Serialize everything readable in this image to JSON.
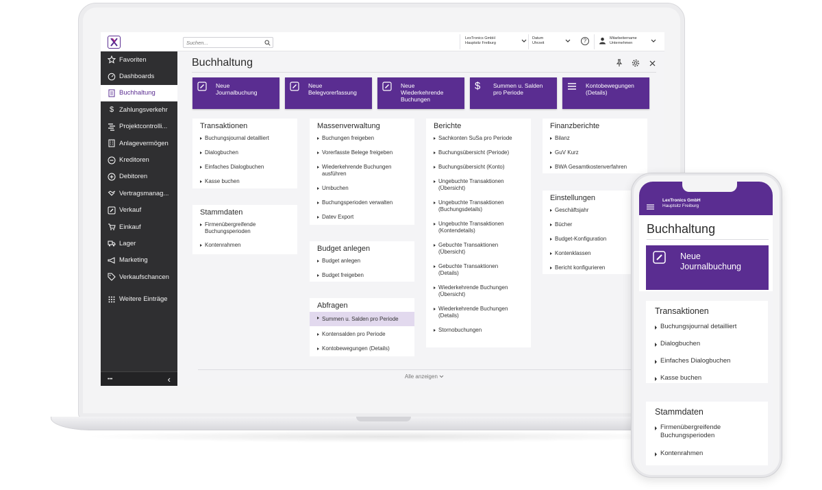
{
  "app": {
    "accent": "#5a2d91"
  },
  "sidebar": {
    "items": [
      {
        "label": "Favoriten",
        "icon": "star-icon"
      },
      {
        "label": "Dashboards",
        "icon": "dashboard-gauge-icon"
      },
      {
        "label": "Buchhaltung",
        "icon": "ledger-icon",
        "active": true
      },
      {
        "label": "Zahlungsverkehr",
        "icon": "dollar-icon"
      },
      {
        "label": "Projektcontrolli...",
        "icon": "project-icon"
      },
      {
        "label": "Anlagevermögen",
        "icon": "building-icon"
      },
      {
        "label": "Kreditoren",
        "icon": "minus-circle-icon"
      },
      {
        "label": "Debitoren",
        "icon": "plus-circle-icon"
      },
      {
        "label": "Vertragsmanag...",
        "icon": "handshake-icon"
      },
      {
        "label": "Verkauf",
        "icon": "edit-icon"
      },
      {
        "label": "Einkauf",
        "icon": "cart-icon"
      },
      {
        "label": "Lager",
        "icon": "truck-icon"
      },
      {
        "label": "Marketing",
        "icon": "megaphone-icon"
      },
      {
        "label": "Verkaufschancen",
        "icon": "tag-icon"
      }
    ],
    "more_label": "Weitere Einträge",
    "footer_dots": "•••",
    "footer_collapse": "‹"
  },
  "topbar": {
    "search_placeholder": "Suchen...",
    "company_line1": "LexTronics GmbH",
    "company_line2": "Hauptsitz Freiburg",
    "date_line1": "Datum",
    "date_line2": "Uhrzeit",
    "help_label": "?",
    "user_line1": "Mitarbeitername",
    "user_line2": "Unternehmen"
  },
  "page": {
    "title": "Buchhaltung"
  },
  "tiles": [
    {
      "label": "Neue\nJournalbuchung",
      "icon": "edit-icon"
    },
    {
      "label": "Neue\nBelegvorerfassung",
      "icon": "edit-icon"
    },
    {
      "label": "Neue\nWiederkehrende\nBuchungen",
      "icon": "edit-icon"
    },
    {
      "label": "Summen u. Salden\npro Periode",
      "icon": "dollar-icon"
    },
    {
      "label": "Kontobewegungen\n(Details)",
      "icon": "list-icon"
    }
  ],
  "cards": {
    "transaktionen": {
      "title": "Transaktionen",
      "items": [
        "Buchungsjournal detailliert",
        "Dialogbuchen",
        "Einfaches Dialogbuchen",
        "Kasse buchen"
      ]
    },
    "stammdaten": {
      "title": "Stammdaten",
      "items": [
        "Firmenübergreifende\nBuchungsperioden",
        "Kontenrahmen"
      ]
    },
    "massenverwaltung": {
      "title": "Massenverwaltung",
      "items": [
        "Buchungen freigeben",
        "Vorerfasste Belege freigeben",
        "Wiederkehrende Buchungen\nausführen",
        "Umbuchen",
        "Buchungsperioden verwalten",
        "Datev Export"
      ]
    },
    "budget": {
      "title": "Budget anlegen",
      "items": [
        "Budget anlegen",
        "Budget freigeben"
      ]
    },
    "abfragen": {
      "title": "Abfragen",
      "items": [
        "Summen u. Salden pro Periode",
        "Kontensalden pro Periode",
        "Kontobewegungen (Details)"
      ]
    },
    "berichte": {
      "title": "Berichte",
      "items": [
        "Sachkonten SuSa pro Periode",
        "Buchungsübersicht (Periode)",
        "Buchungsübersicht (Konto)",
        "Ungebuchte Transaktionen\n(Übersicht)",
        "Ungebuchte Transaktionen\n(Buchungsdetails)",
        "Ungebuchte Transaktionen\n(Kontendetails)",
        "Gebuchte Transaktionen\n(Übersicht)",
        "Gebuchte Transaktionen\n(Details)",
        "Wiederkehrende Buchungen\n(Übersicht)",
        "Wiederkehrende Buchungen\n(Details)",
        "Stornobuchungen"
      ]
    },
    "finanzberichte": {
      "title": "Finanzberichte",
      "items": [
        "Bilanz",
        "GuV Kurz",
        "BWA Gesamtkostenverfahren"
      ]
    },
    "einstellungen": {
      "title": "Einstellungen",
      "items": [
        "Geschäftsjahr",
        "Bücher",
        "Budget-Konfiguration",
        "Kontenklassen",
        "Bericht konfigurieren"
      ]
    }
  },
  "show_all": "Alle anzeigen",
  "phone": {
    "company_line1": "LexTronics GmbH",
    "company_line2": "Hauptsitz Freiburg",
    "title": "Buchhaltung",
    "tile_label": "Neue\nJournalbuchung",
    "transaktionen_title": "Transaktionen",
    "transaktionen_items": [
      "Buchungsjournal detailliert",
      "Dialogbuchen",
      "Einfaches Dialogbuchen",
      "Kasse buchen"
    ],
    "stammdaten_title": "Stammdaten",
    "stammdaten_items": [
      "Firmenübergreifende\nBuchungsperioden",
      "Kontenrahmen"
    ]
  }
}
